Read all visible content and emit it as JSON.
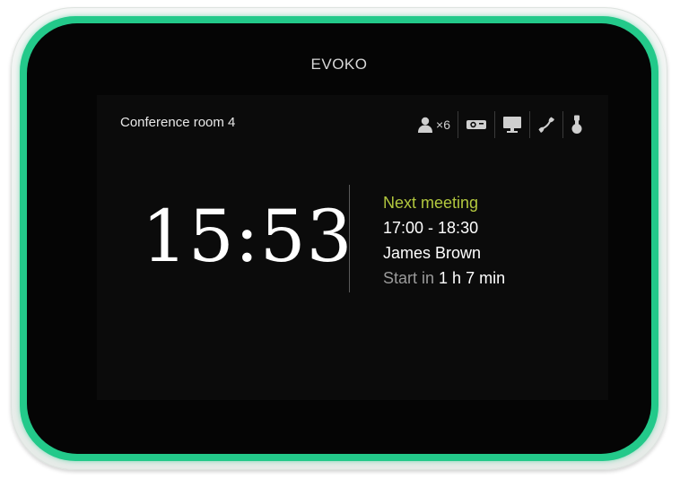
{
  "device": {
    "brand": "EVOKO",
    "led_color": "#23c98a"
  },
  "room": {
    "name": "Conference room 4",
    "amenities": [
      {
        "icon": "person-icon",
        "label": "×6"
      },
      {
        "icon": "projector-icon",
        "label": ""
      },
      {
        "icon": "monitor-icon",
        "label": ""
      },
      {
        "icon": "phone-icon",
        "label": ""
      },
      {
        "icon": "lightbulb-icon",
        "label": ""
      }
    ]
  },
  "clock": {
    "time": "15:53"
  },
  "next_meeting": {
    "heading": "Next meeting",
    "time_range": "17:00 - 18:30",
    "organizer": "James Brown",
    "start_prefix": "Start in",
    "start_remaining": "1 h 7 min"
  },
  "colors": {
    "accent_green": "#b2c73e",
    "background": "#050505",
    "text": "#ffffff",
    "muted_text": "#9a9a9a"
  }
}
